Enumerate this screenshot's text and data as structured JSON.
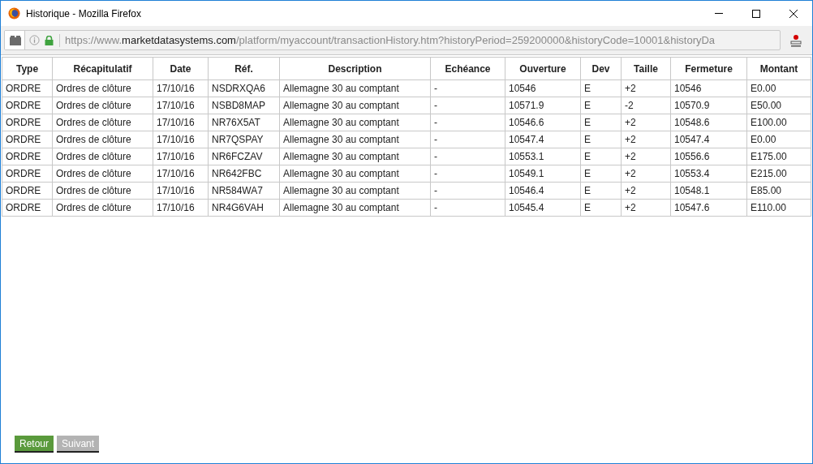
{
  "window": {
    "title": "Historique - Mozilla Firefox"
  },
  "address_bar": {
    "scheme": "https://www.",
    "domain": "marketdatasystems.com",
    "path": "/platform/myaccount/transactionHistory.htm?historyPeriod=259200000&historyCode=10001&historyDa"
  },
  "table": {
    "columns": [
      "Type",
      "Récapitulatif",
      "Date",
      "Réf.",
      "Description",
      "Echéance",
      "Ouverture",
      "Dev",
      "Taille",
      "Fermeture",
      "Montant"
    ],
    "rows": [
      [
        "ORDRE",
        "Ordres de clôture",
        "17/10/16",
        "NSDRXQA6",
        "Allemagne 30 au comptant",
        "-",
        "10546",
        "E",
        "+2",
        "10546",
        "E0.00"
      ],
      [
        "ORDRE",
        "Ordres de clôture",
        "17/10/16",
        "NSBD8MAP",
        "Allemagne 30 au comptant",
        "-",
        "10571.9",
        "E",
        "-2",
        "10570.9",
        "E50.00"
      ],
      [
        "ORDRE",
        "Ordres de clôture",
        "17/10/16",
        "NR76X5AT",
        "Allemagne 30 au comptant",
        "-",
        "10546.6",
        "E",
        "+2",
        "10548.6",
        "E100.00"
      ],
      [
        "ORDRE",
        "Ordres de clôture",
        "17/10/16",
        "NR7QSPAY",
        "Allemagne 30 au comptant",
        "-",
        "10547.4",
        "E",
        "+2",
        "10547.4",
        "E0.00"
      ],
      [
        "ORDRE",
        "Ordres de clôture",
        "17/10/16",
        "NR6FCZAV",
        "Allemagne 30 au comptant",
        "-",
        "10553.1",
        "E",
        "+2",
        "10556.6",
        "E175.00"
      ],
      [
        "ORDRE",
        "Ordres de clôture",
        "17/10/16",
        "NR642FBC",
        "Allemagne 30 au comptant",
        "-",
        "10549.1",
        "E",
        "+2",
        "10553.4",
        "E215.00"
      ],
      [
        "ORDRE",
        "Ordres de clôture",
        "17/10/16",
        "NR584WA7",
        "Allemagne 30 au comptant",
        "-",
        "10546.4",
        "E",
        "+2",
        "10548.1",
        "E85.00"
      ],
      [
        "ORDRE",
        "Ordres de clôture",
        "17/10/16",
        "NR4G6VAH",
        "Allemagne 30 au comptant",
        "-",
        "10545.4",
        "E",
        "+2",
        "10547.6",
        "E110.00"
      ]
    ]
  },
  "buttons": [
    {
      "label": "Retour",
      "disabled": false
    },
    {
      "label": "Suivant",
      "disabled": true
    }
  ]
}
